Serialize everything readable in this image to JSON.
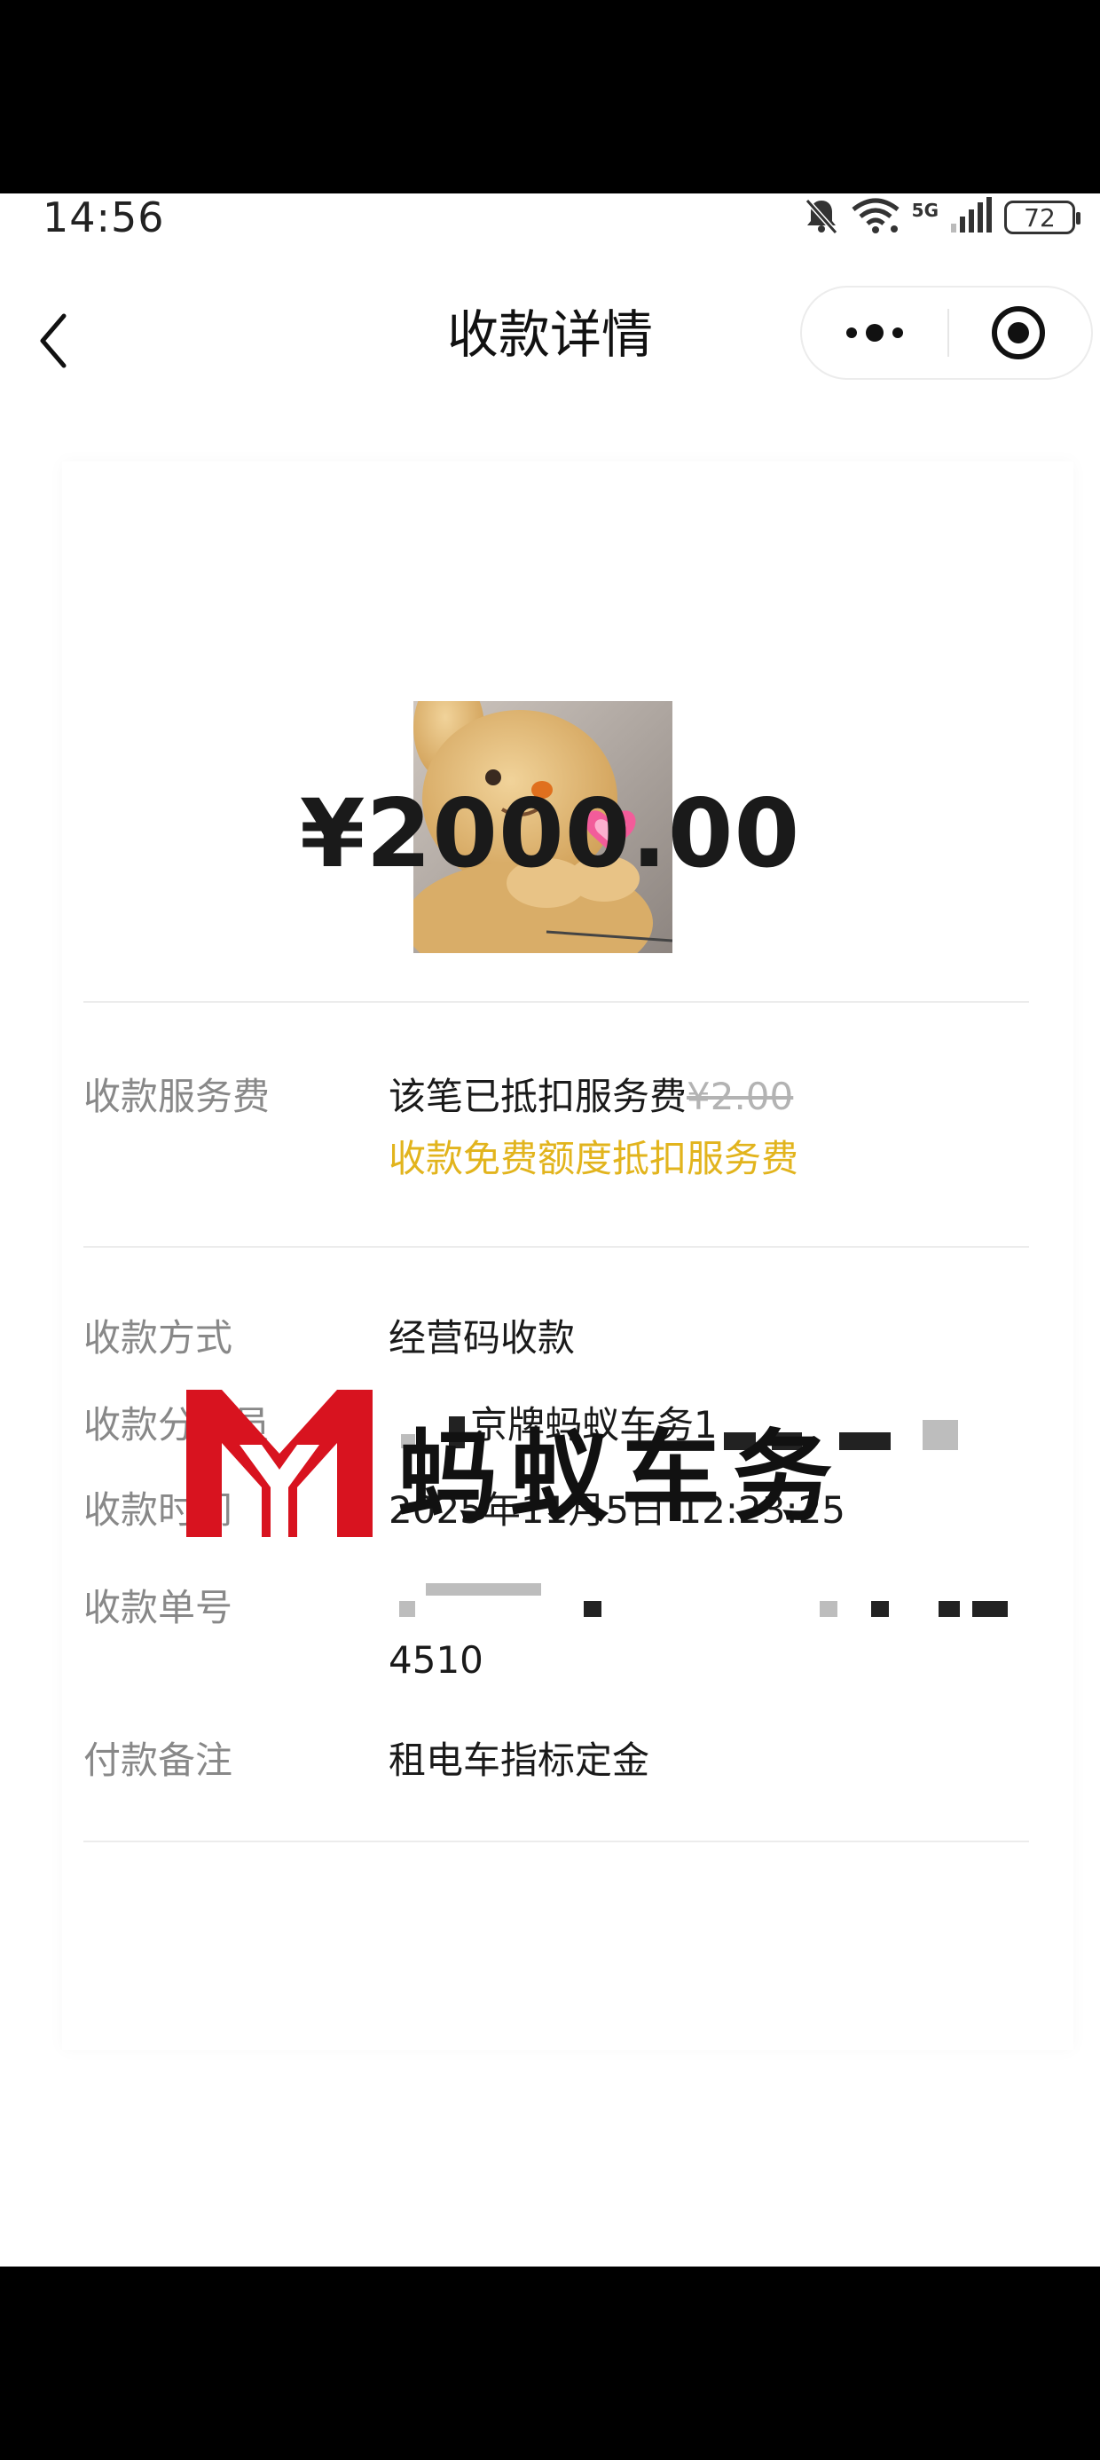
{
  "status_bar": {
    "time": "14:56",
    "network": "5G",
    "battery": "72"
  },
  "nav": {
    "title": "收款详情"
  },
  "payment": {
    "amount": "¥2000.00"
  },
  "details": {
    "fee_label": "收款服务费",
    "fee_value": "该笔已抵扣服务费",
    "fee_original": "¥2.00",
    "fee_note": "收款免费额度抵扣服务费",
    "method_label": "收款方式",
    "method_value": "经营码收款",
    "distributor_label": "收款分销员",
    "distributor_value": "京牌蚂蚁车务1",
    "time_label": "收款时间",
    "time_value": "2025年11月5日 12:23:25",
    "order_label": "收款单号",
    "order_value_tail": "4510",
    "remark_label": "付款备注",
    "remark_value": "租电车指标定金"
  },
  "watermark": {
    "text": "蚂蚁车务",
    "logo_letters": "MY"
  },
  "colors": {
    "highlight_yellow": "#e2b41d",
    "label_gray": "#888888",
    "logo_red": "#d8131f"
  }
}
